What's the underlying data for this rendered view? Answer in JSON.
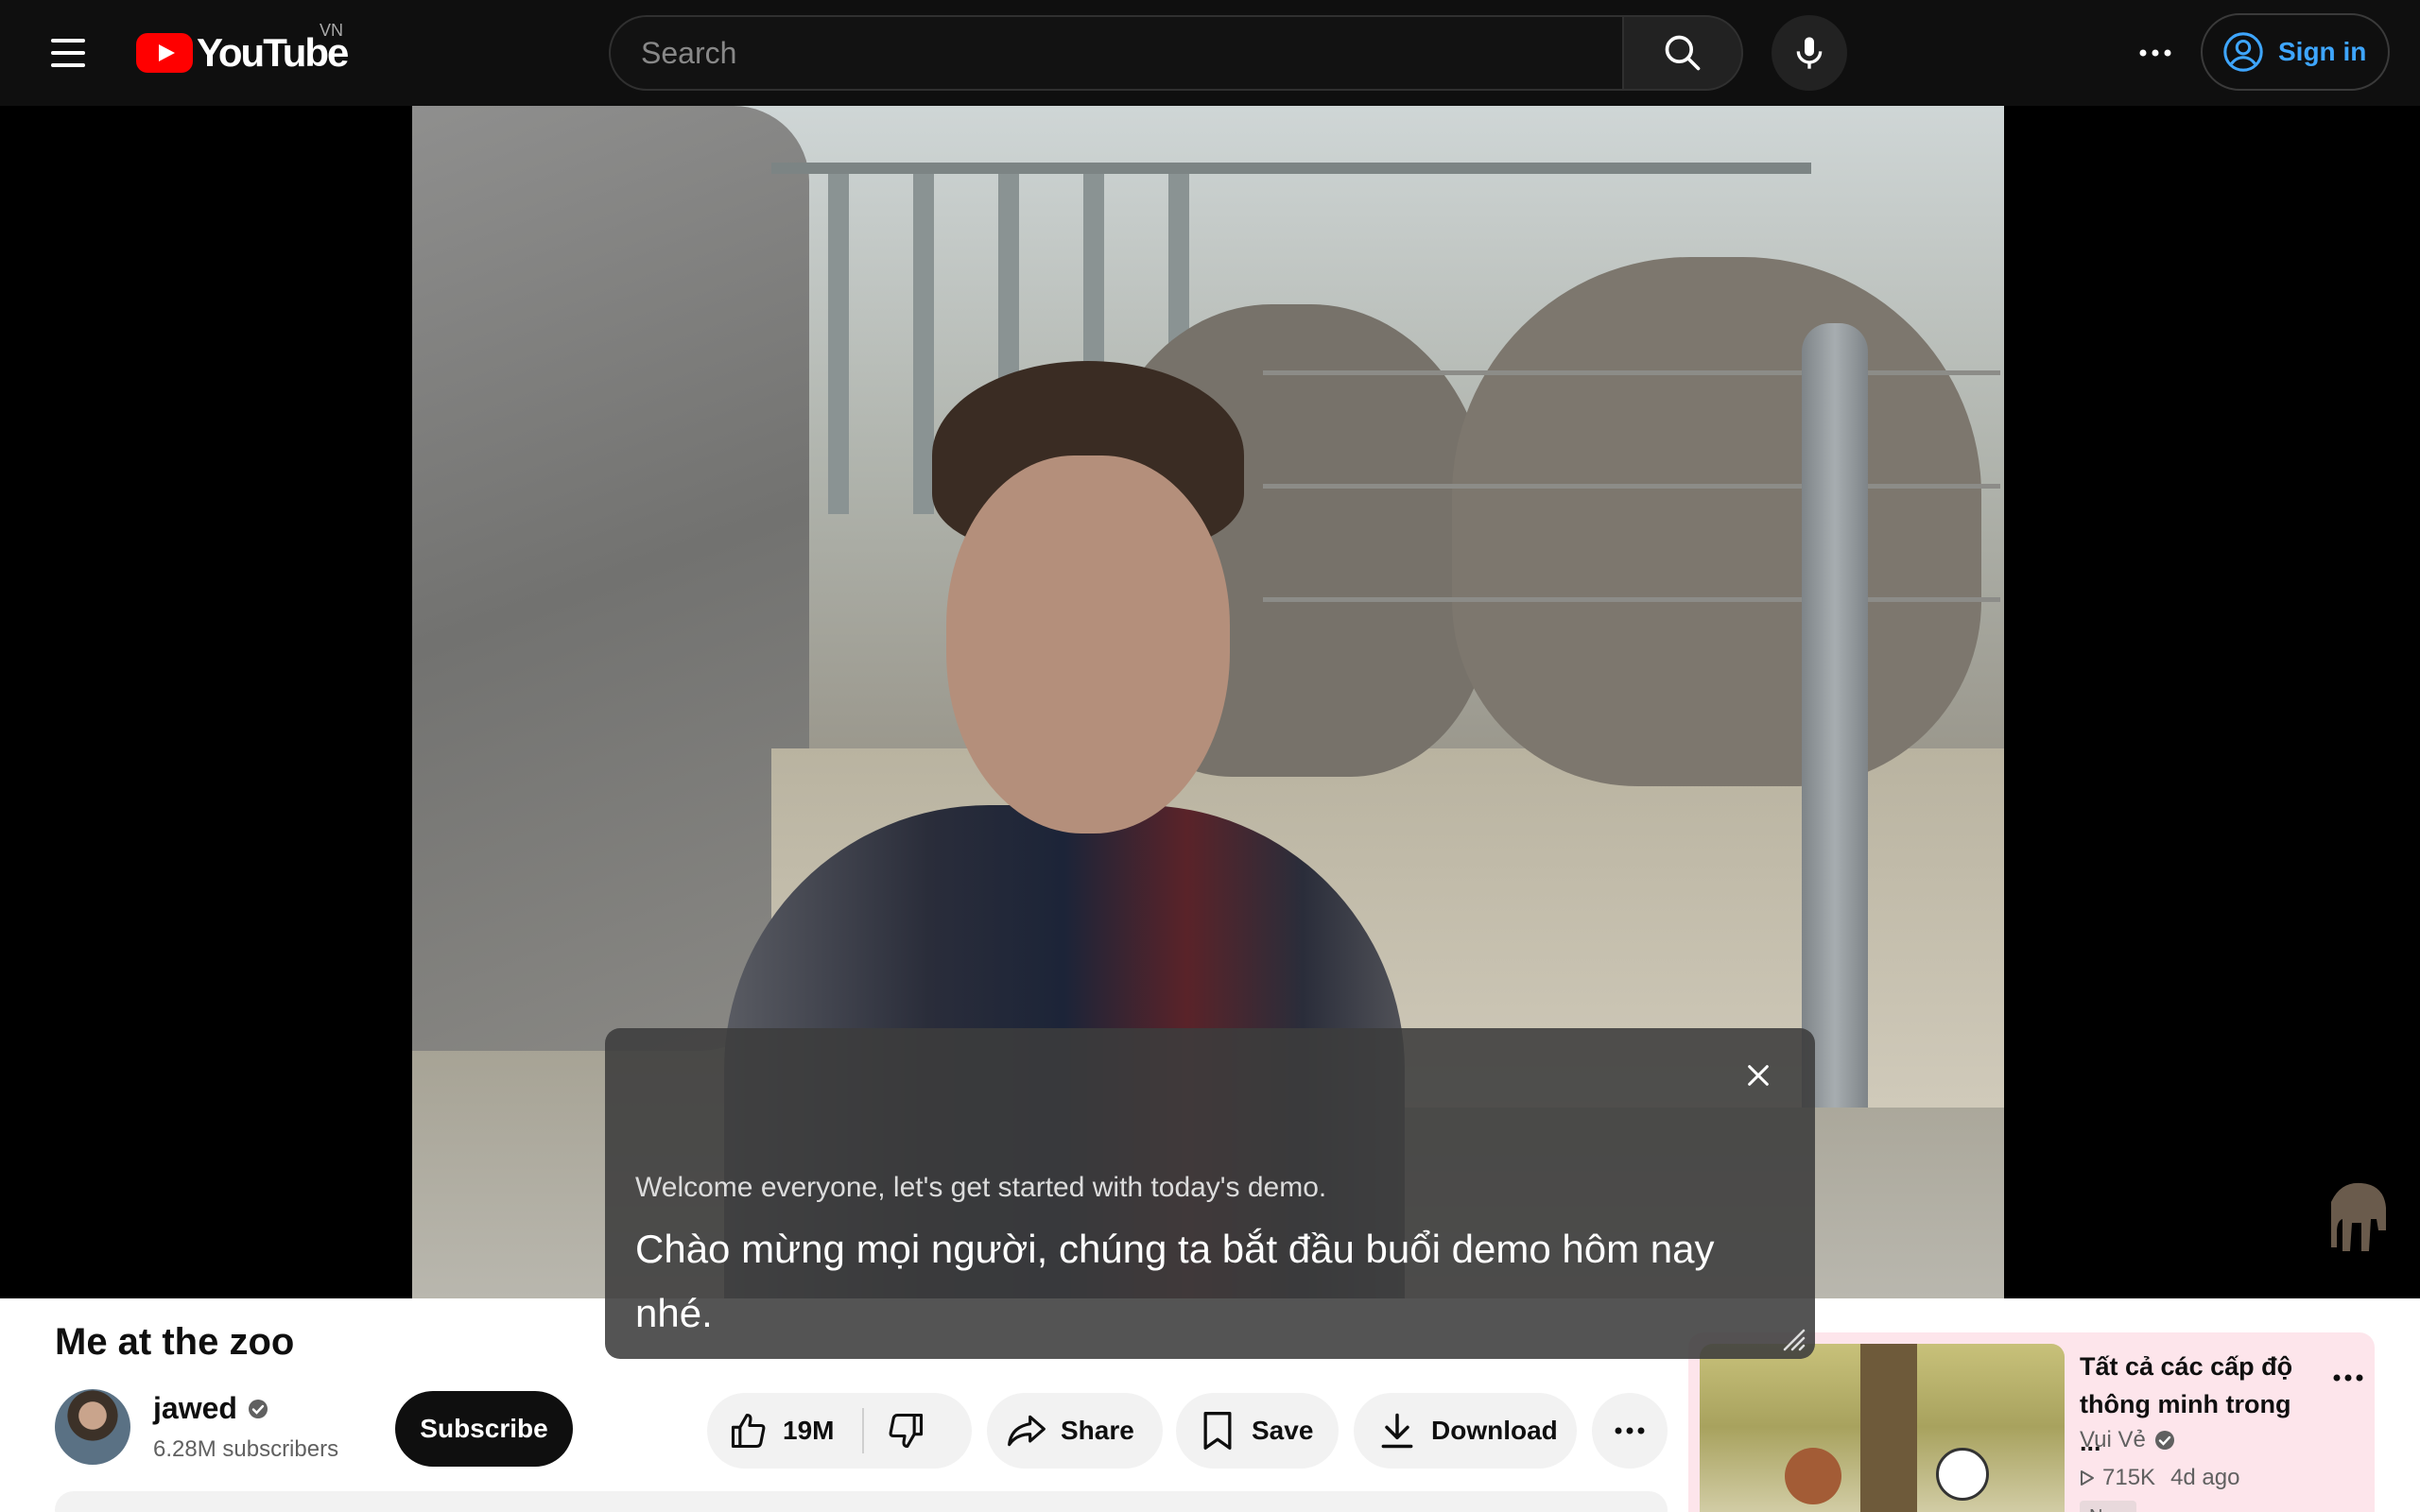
{
  "header": {
    "logo_text": "YouTube",
    "country_code": "VN",
    "search_placeholder": "Search",
    "sign_in_label": "Sign in"
  },
  "player": {
    "caption_english": "Welcome everyone, let's get started with today's demo.",
    "caption_vietnamese": "Chào mừng mọi người, chúng ta bắt đầu buổi demo hôm nay nhé."
  },
  "video": {
    "title": "Me at the zoo",
    "channel_name": "jawed",
    "subscribers": "6.28M subscribers",
    "subscribe_label": "Subscribe",
    "like_count": "19M",
    "share_label": "Share",
    "save_label": "Save",
    "download_label": "Download"
  },
  "recommendation": {
    "title": "Tất cả các cấp độ thông minh trong ...",
    "channel": "Vui Vẻ",
    "views": "715K",
    "age": "4d ago",
    "badge": "New"
  },
  "colors": {
    "brand_red": "#ff0000",
    "link_blue": "#3ea6ff",
    "header_bg": "#0f0f0f",
    "rec_card_bg": "#fde5eb"
  }
}
